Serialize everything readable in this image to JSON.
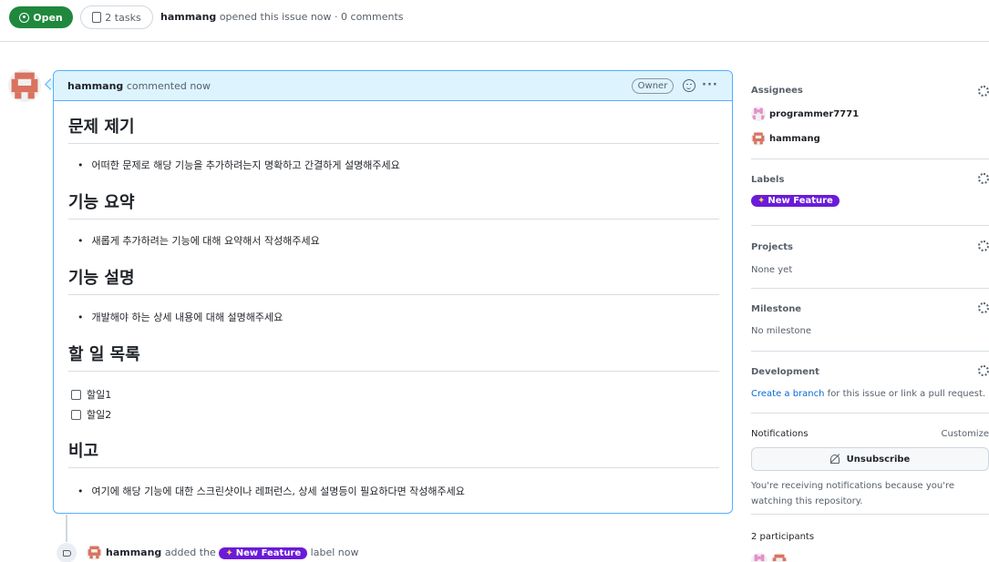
{
  "header": {
    "status": "Open",
    "tasks": "2 tasks",
    "author": "hammang",
    "meta": "opened this issue now · 0 comments"
  },
  "comment": {
    "author": "hammang",
    "when": "commented now",
    "role": "Owner",
    "more": "···",
    "sections": [
      {
        "heading": "문제 제기",
        "bullet": "어떠한 문제로 해당 기능을 추가하려는지 명확하고 간결하게 설명해주세요"
      },
      {
        "heading": "기능 요약",
        "bullet": "새롭게 추가하려는 기능에 대해 요약해서 작성해주세요"
      },
      {
        "heading": "기능 설명",
        "bullet": "개발해야 하는 상세 내용에 대해 설명해주세요"
      },
      {
        "heading": "할 일 목록",
        "tasks": [
          "할일1",
          "할일2"
        ]
      },
      {
        "heading": "비고",
        "bullet": "여기에 해당 기능에 대한 스크린샷이나 레퍼런스, 상세 설명등이 필요하다면 작성해주세요"
      }
    ]
  },
  "timeline": {
    "actor": "hammang",
    "action_pre": "added the",
    "label": "New Feature",
    "action_post": "label now"
  },
  "sidebar": {
    "assignees": {
      "title": "Assignees",
      "people": [
        "programmer7771",
        "hammang"
      ]
    },
    "labels": {
      "title": "Labels",
      "label": "New Feature"
    },
    "projects": {
      "title": "Projects",
      "value": "None yet"
    },
    "milestone": {
      "title": "Milestone",
      "value": "No milestone"
    },
    "development": {
      "title": "Development",
      "link": "Create a branch",
      "rest": "for this issue or link a pull request."
    },
    "notifications": {
      "title": "Notifications",
      "customize": "Customize",
      "button": "Unsubscribe",
      "note": "You're receiving notifications because you're watching this repository."
    },
    "participants": {
      "title": "2 participants"
    }
  },
  "colors": {
    "open": "#1f883d",
    "label": "#6a1bd9",
    "accent": "#54aeff",
    "link": "#0969da"
  }
}
